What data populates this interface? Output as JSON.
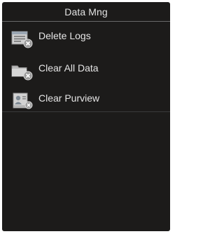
{
  "screen": {
    "title": "Data Mng"
  },
  "menu": {
    "items": [
      {
        "label": "Delete Logs",
        "icon": "delete-logs-icon"
      },
      {
        "label": "Clear All Data",
        "icon": "clear-all-data-icon"
      },
      {
        "label": "Clear Purview",
        "icon": "clear-purview-icon"
      }
    ]
  },
  "colors": {
    "background": "#1c1b1a",
    "text": "#e6e6e6",
    "divider": "#6a6a6a"
  }
}
